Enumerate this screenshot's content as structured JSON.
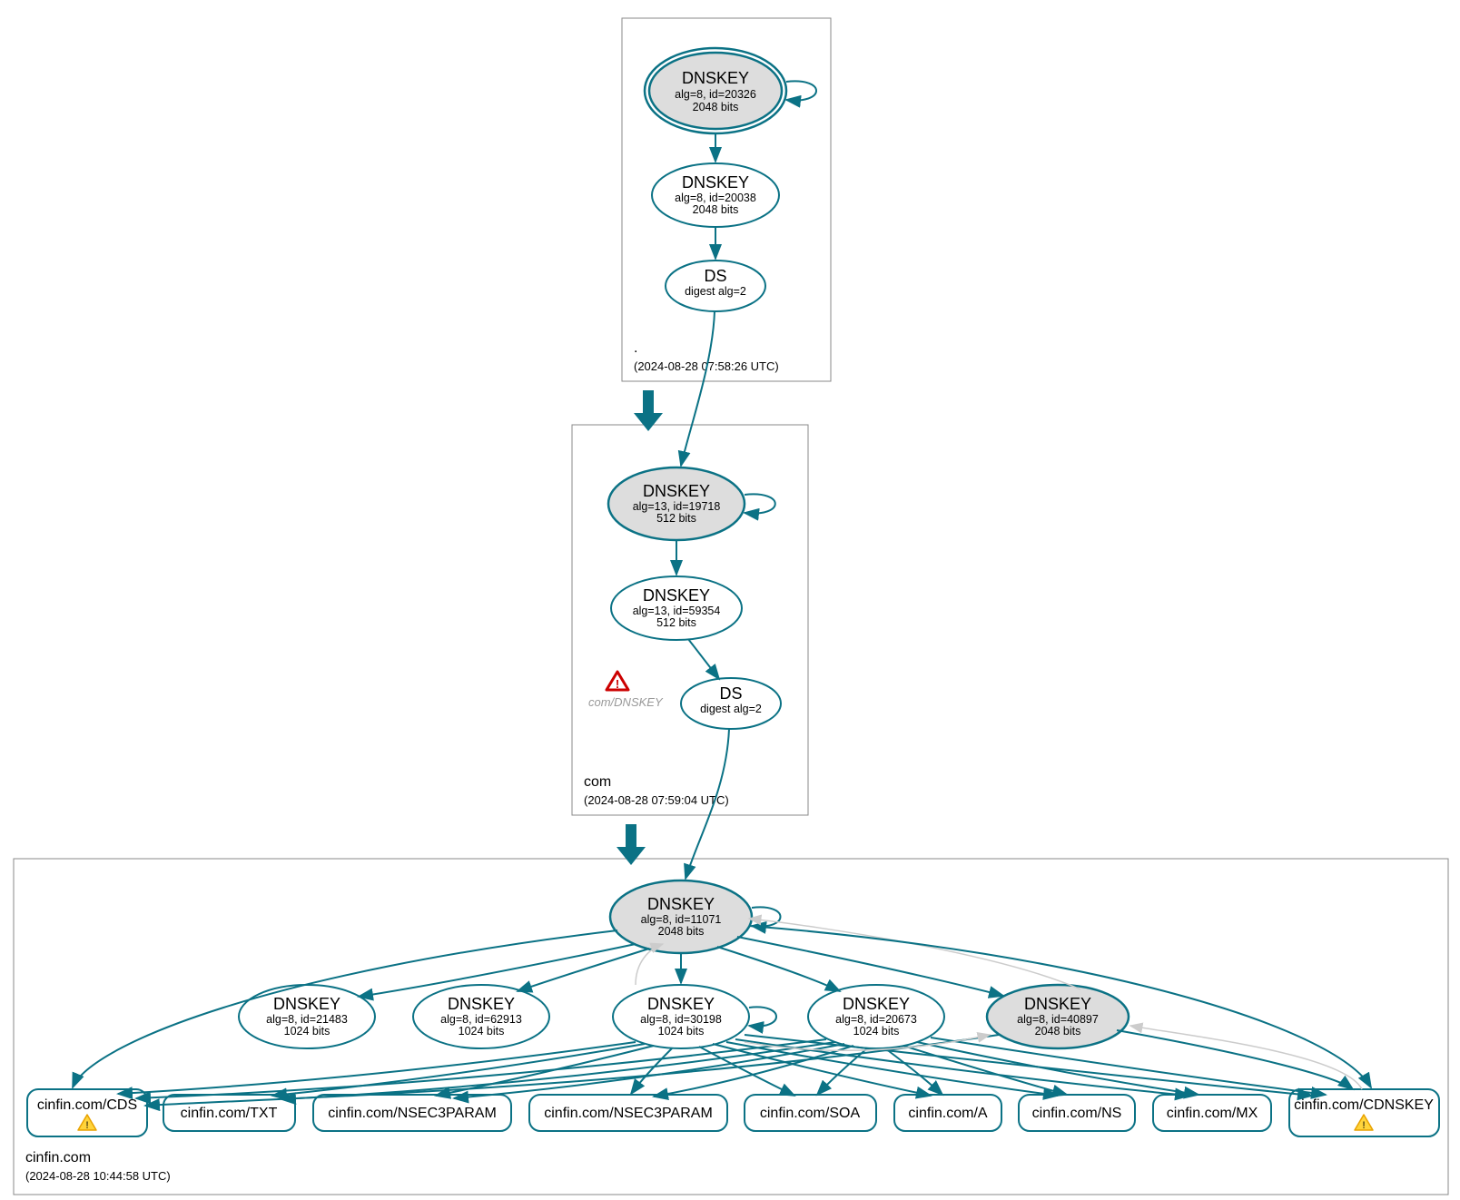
{
  "zones": {
    "root": {
      "name": ".",
      "timestamp": "(2024-08-28 07:58:26 UTC)",
      "ksk": {
        "title": "DNSKEY",
        "line1": "alg=8, id=20326",
        "line2": "2048 bits"
      },
      "zsk": {
        "title": "DNSKEY",
        "line1": "alg=8, id=20038",
        "line2": "2048 bits"
      },
      "ds": {
        "title": "DS",
        "line1": "digest alg=2"
      }
    },
    "com": {
      "name": "com",
      "timestamp": "(2024-08-28 07:59:04 UTC)",
      "ksk": {
        "title": "DNSKEY",
        "line1": "alg=13, id=19718",
        "line2": "512 bits"
      },
      "zsk": {
        "title": "DNSKEY",
        "line1": "alg=13, id=59354",
        "line2": "512 bits"
      },
      "ds": {
        "title": "DS",
        "line1": "digest alg=2"
      },
      "warn_label": "com/DNSKEY"
    },
    "cinfin": {
      "name": "cinfin.com",
      "timestamp": "(2024-08-28 10:44:58 UTC)",
      "ksk": {
        "title": "DNSKEY",
        "line1": "alg=8, id=11071",
        "line2": "2048 bits"
      },
      "zsk_a": {
        "title": "DNSKEY",
        "line1": "alg=8, id=21483",
        "line2": "1024 bits"
      },
      "zsk_b": {
        "title": "DNSKEY",
        "line1": "alg=8, id=62913",
        "line2": "1024 bits"
      },
      "zsk_c": {
        "title": "DNSKEY",
        "line1": "alg=8, id=30198",
        "line2": "1024 bits"
      },
      "zsk_d": {
        "title": "DNSKEY",
        "line1": "alg=8, id=20673",
        "line2": "1024 bits"
      },
      "ksk2": {
        "title": "DNSKEY",
        "line1": "alg=8, id=40897",
        "line2": "2048 bits"
      }
    }
  },
  "records": {
    "cds": "cinfin.com/CDS",
    "txt": "cinfin.com/TXT",
    "nsec3a": "cinfin.com/NSEC3PARAM",
    "nsec3b": "cinfin.com/NSEC3PARAM",
    "soa": "cinfin.com/SOA",
    "a": "cinfin.com/A",
    "ns": "cinfin.com/NS",
    "mx": "cinfin.com/MX",
    "cdnskey": "cinfin.com/CDNSKEY"
  }
}
